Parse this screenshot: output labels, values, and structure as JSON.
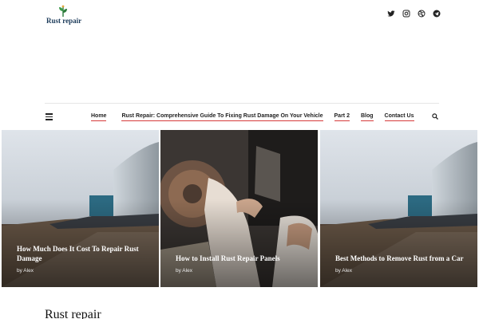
{
  "site": {
    "logo_text": "Rust repair",
    "heading": "Rust repair"
  },
  "social": [
    "twitter-icon",
    "instagram-icon",
    "dribbble-icon",
    "telegram-icon"
  ],
  "nav": {
    "items": [
      {
        "label": "Home"
      },
      {
        "label": "Rust Repair: Comprehensive Guide To Fixing Rust Damage On Your Vehicle"
      },
      {
        "label": "Part 2"
      },
      {
        "label": "Blog"
      },
      {
        "label": "Contact Us"
      }
    ],
    "accent": "#d63b3b"
  },
  "cards": [
    {
      "title": "How Much Does It Cost To Repair Rust Damage",
      "author": "by Alex"
    },
    {
      "title": "How to Install Rust Repair Panels",
      "author": "by Alex"
    },
    {
      "title": "Best Methods to Remove Rust from a Car",
      "author": "by Alex"
    }
  ]
}
